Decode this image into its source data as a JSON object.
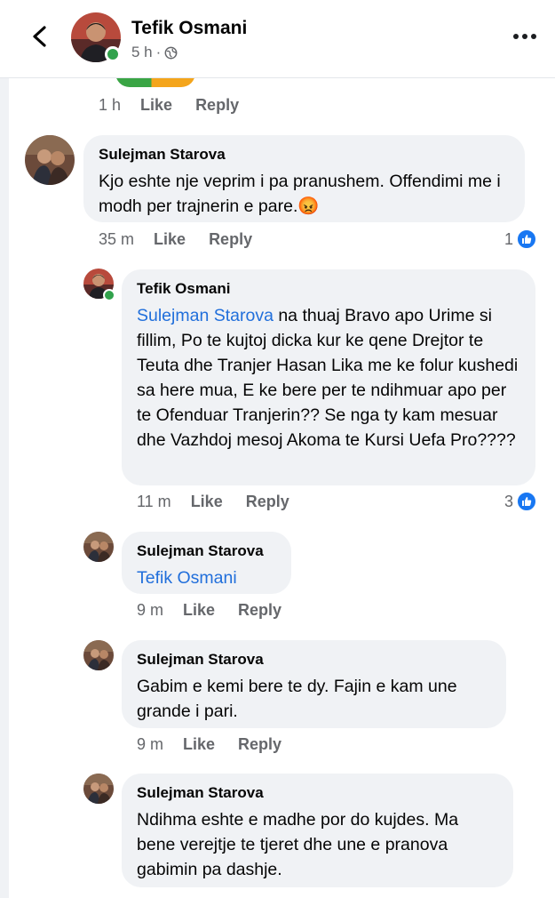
{
  "header": {
    "name": "Tefik Osmani",
    "time": "5 h",
    "dot": "·",
    "back_icon": "chevron-left-icon",
    "privacy_icon": "globe-icon",
    "more_icon": "more-horizontal-icon"
  },
  "colors": {
    "link": "#216fdb",
    "muted": "#65676b",
    "bubble": "#f0f2f5",
    "like": "#1877f2",
    "online": "#31a24c"
  },
  "top_actions": {
    "time": "1 h",
    "like": "Like",
    "reply": "Reply"
  },
  "comments": [
    {
      "author": "Sulejman Starova",
      "text": "Kjo eshte nje veprim i pa pranushem. Offendimi me i modh per trajnerin e pare.",
      "emoji": "😡",
      "time": "35 m",
      "like": "Like",
      "reply": "Reply",
      "reactions": "1"
    },
    {
      "author": "Tefik Osmani",
      "mention": "Sulejman Starova",
      "text": " na thuaj Bravo apo Urime si fillim, Po te kujtoj dicka kur ke qene Drejtor te Teuta dhe Tranjer Hasan Lika me ke folur kushedi sa here mua, E ke bere per te ndihmuar apo per te Ofenduar Tranjerin?? Se nga ty kam mesuar dhe Vazhdoj mesoj Akoma te Kursi Uefa Pro????",
      "time": "11 m",
      "like": "Like",
      "reply": "Reply",
      "reactions": "3"
    },
    {
      "author": "Sulejman Starova",
      "mention": "Tefik Osmani",
      "time": "9 m",
      "like": "Like",
      "reply": "Reply"
    },
    {
      "author": "Sulejman Starova",
      "text": "Gabim e kemi bere te dy. Fajin e kam une grande i pari.",
      "time": "9 m",
      "like": "Like",
      "reply": "Reply"
    },
    {
      "author": "Sulejman Starova",
      "text": "Ndihma eshte e madhe por do kujdes. Ma bene verejtje te tjeret dhe une e pranova gabimin pa dashje."
    }
  ]
}
